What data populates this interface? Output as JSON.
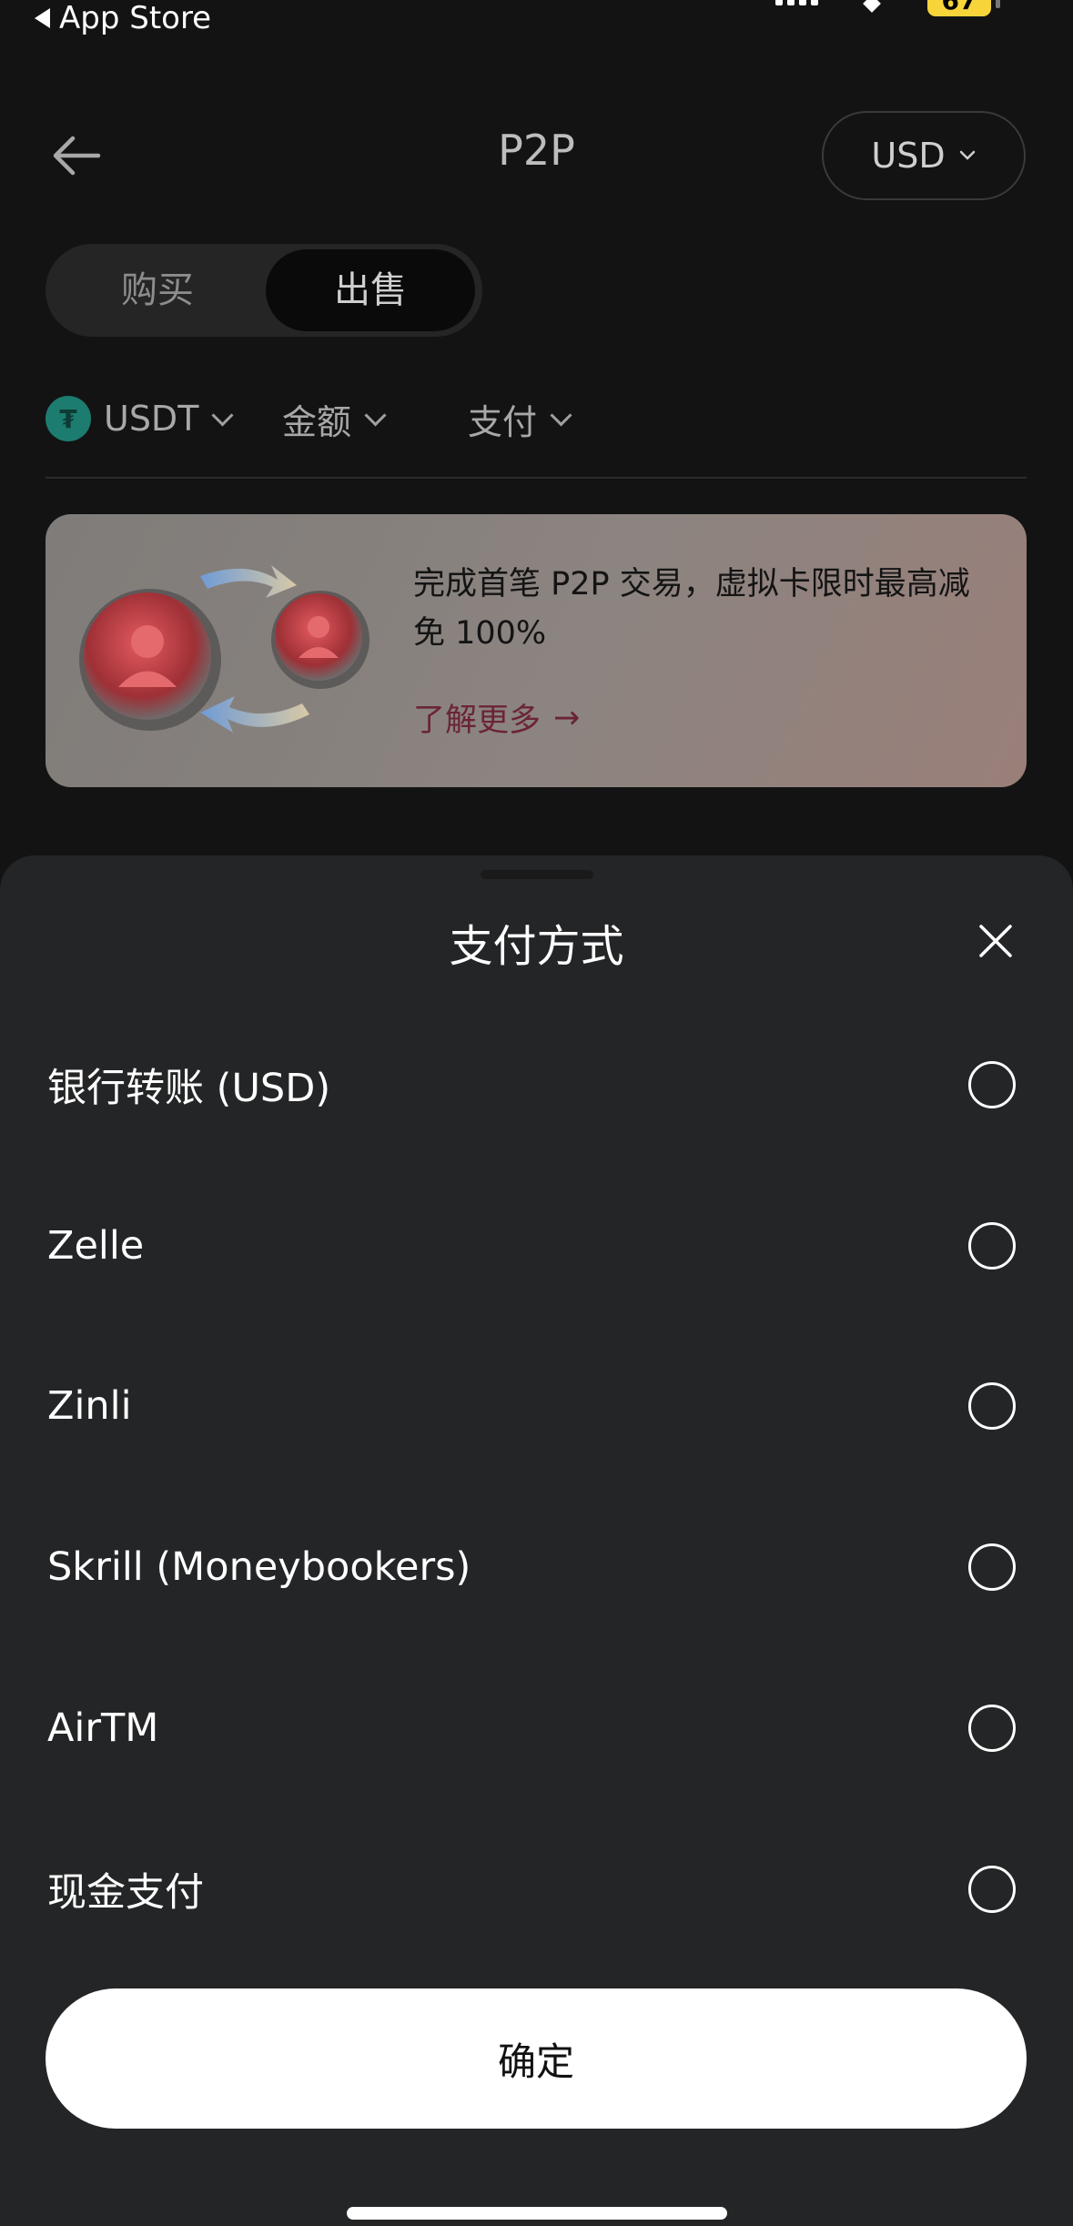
{
  "status_bar": {
    "back_label": "App Store",
    "battery": "67",
    "battery_color": "#f7d43a"
  },
  "header": {
    "title": "P2P",
    "currency": "USD"
  },
  "toggle": {
    "buy": "购买",
    "sell": "出售",
    "selected": "sell"
  },
  "filters": {
    "coin": "USDT",
    "amount": "金额",
    "payment": "支付"
  },
  "banner": {
    "text": "完成首笔 P2P 交易，虚拟卡限时最高减免 100%",
    "link": "了解更多",
    "link_arrow": "→"
  },
  "sheet": {
    "title": "支付方式",
    "options": [
      {
        "label": "银行转账 (USD)",
        "checked": false
      },
      {
        "label": "Zelle",
        "checked": false
      },
      {
        "label": "Zinli",
        "checked": false
      },
      {
        "label": "Skrill (Moneybookers)",
        "checked": false
      },
      {
        "label": "AirTM",
        "checked": false
      },
      {
        "label": "现金支付",
        "checked": false
      }
    ],
    "confirm": "确定"
  },
  "colors": {
    "sheet_bg": "#242526",
    "accent_usdt": "#1d7c70",
    "link_color": "#6b2436"
  }
}
